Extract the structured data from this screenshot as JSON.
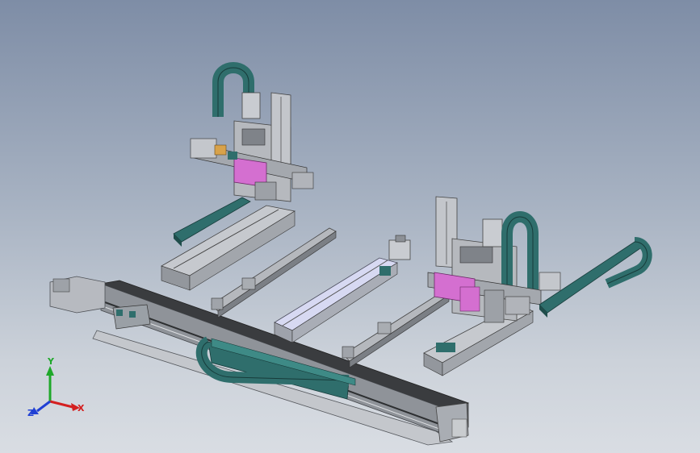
{
  "viewport": {
    "background_top": "#7e8da6",
    "background_bottom": "#d9dde3"
  },
  "colors": {
    "cable_chain": "#2f6e6c",
    "cable_chain_light": "#3e8a86",
    "frame_metal": "#b9bcc2",
    "frame_dark": "#6f737a",
    "carriage_plate": "#d46fd0",
    "rail_dark": "#3d3f42",
    "motor": "#c9ccd1"
  },
  "triad": {
    "x_label": "X",
    "y_label": "Y",
    "z_label": "Z",
    "x_color": "#d42020",
    "y_color": "#1fa82a",
    "z_color": "#2040d4"
  }
}
